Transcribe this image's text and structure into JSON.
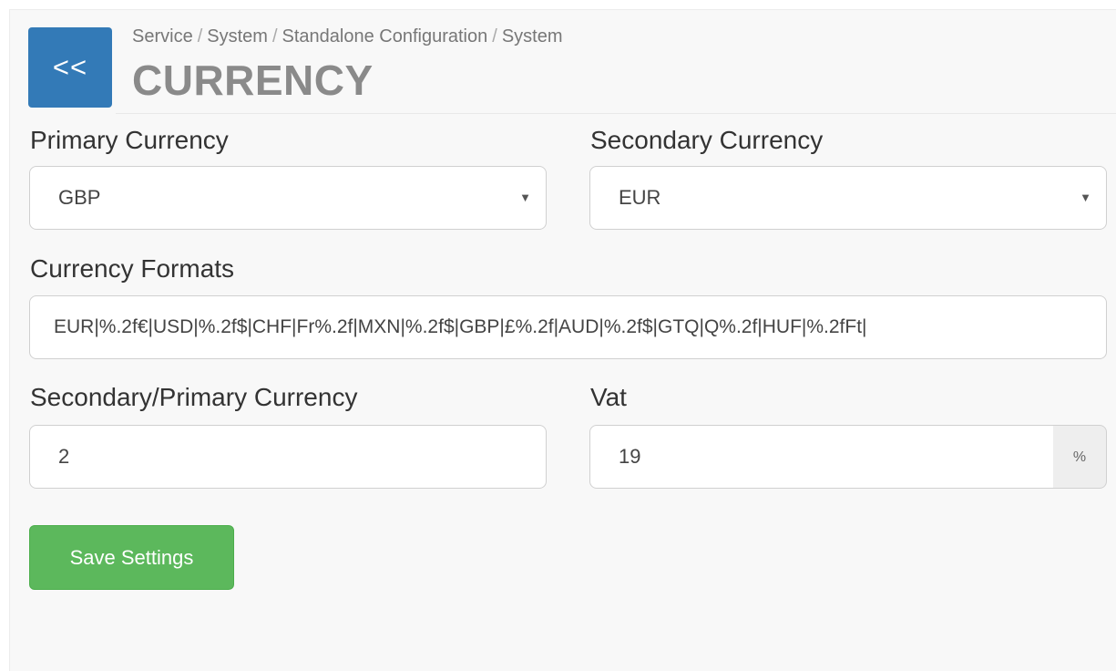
{
  "header": {
    "back_label": "<<",
    "breadcrumb": [
      "Service",
      "System",
      "Standalone Configuration",
      "System"
    ],
    "breadcrumb_separator": "/",
    "title": "CURRENCY"
  },
  "form": {
    "primary_currency": {
      "label": "Primary Currency",
      "value": "GBP"
    },
    "secondary_currency": {
      "label": "Secondary Currency",
      "value": "EUR"
    },
    "currency_formats": {
      "label": "Currency Formats",
      "value": "EUR|%.2f€|USD|%.2f$|CHF|Fr%.2f|MXN|%.2f$|GBP|£%.2f|AUD|%.2f$|GTQ|Q%.2f|HUF|%.2fFt|"
    },
    "exchange_rate": {
      "label": "Secondary/Primary Currency",
      "value": "2"
    },
    "vat": {
      "label": "Vat",
      "value": "19",
      "suffix": "%"
    },
    "save_label": "Save Settings"
  },
  "colors": {
    "back_button": "#337ab7",
    "save_button": "#5cb85c",
    "panel_background": "#f8f8f8"
  },
  "icons": {
    "dropdown": "caret-down-icon"
  }
}
